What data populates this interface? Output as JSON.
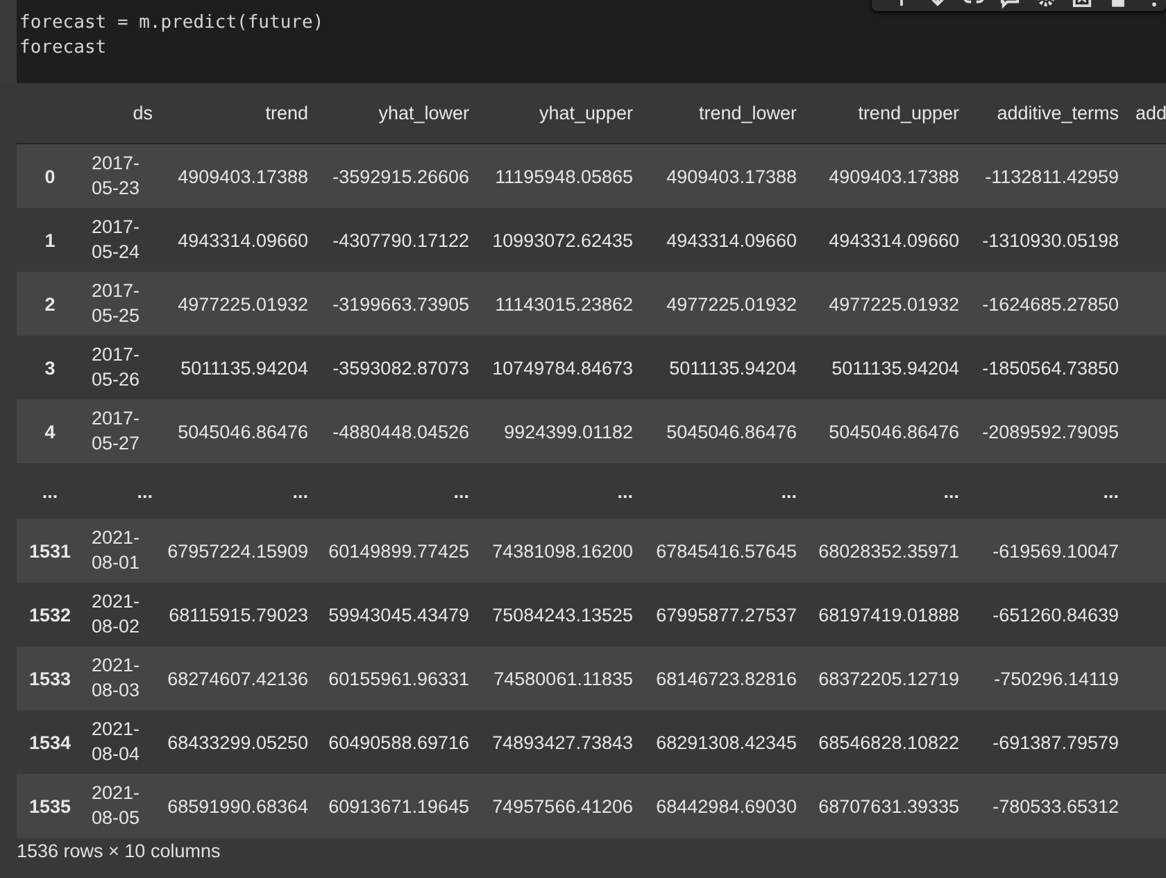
{
  "code_cell": {
    "lines": [
      "forecast = m.predict(future)",
      "forecast"
    ]
  },
  "table": {
    "columns": [
      "ds",
      "trend",
      "yhat_lower",
      "yhat_upper",
      "trend_lower",
      "trend_upper",
      "additive_terms",
      "add"
    ],
    "rows": [
      {
        "kind": "data",
        "index": "0",
        "cells": [
          "2017-05-23",
          "4909403.17388",
          "-3592915.26606",
          "11195948.05865",
          "4909403.17388",
          "4909403.17388",
          "-1132811.42959"
        ]
      },
      {
        "kind": "data",
        "index": "1",
        "cells": [
          "2017-05-24",
          "4943314.09660",
          "-4307790.17122",
          "10993072.62435",
          "4943314.09660",
          "4943314.09660",
          "-1310930.05198"
        ]
      },
      {
        "kind": "data",
        "index": "2",
        "cells": [
          "2017-05-25",
          "4977225.01932",
          "-3199663.73905",
          "11143015.23862",
          "4977225.01932",
          "4977225.01932",
          "-1624685.27850"
        ]
      },
      {
        "kind": "data",
        "index": "3",
        "cells": [
          "2017-05-26",
          "5011135.94204",
          "-3593082.87073",
          "10749784.84673",
          "5011135.94204",
          "5011135.94204",
          "-1850564.73850"
        ]
      },
      {
        "kind": "data",
        "index": "4",
        "cells": [
          "2017-05-27",
          "5045046.86476",
          "-4880448.04526",
          "9924399.01182",
          "5045046.86476",
          "5045046.86476",
          "-2089592.79095"
        ]
      },
      {
        "kind": "ellipsis",
        "index": "...",
        "cells": [
          "...",
          "...",
          "...",
          "...",
          "...",
          "...",
          "..."
        ]
      },
      {
        "kind": "data",
        "index": "1531",
        "cells": [
          "2021-08-01",
          "67957224.15909",
          "60149899.77425",
          "74381098.16200",
          "67845416.57645",
          "68028352.35971",
          "-619569.10047"
        ]
      },
      {
        "kind": "data",
        "index": "1532",
        "cells": [
          "2021-08-02",
          "68115915.79023",
          "59943045.43479",
          "75084243.13525",
          "67995877.27537",
          "68197419.01888",
          "-651260.84639"
        ]
      },
      {
        "kind": "data",
        "index": "1533",
        "cells": [
          "2021-08-03",
          "68274607.42136",
          "60155961.96331",
          "74580061.11835",
          "68146723.82816",
          "68372205.12719",
          "-750296.14119"
        ]
      },
      {
        "kind": "data",
        "index": "1534",
        "cells": [
          "2021-08-04",
          "68433299.05250",
          "60490588.69716",
          "74893427.73843",
          "68291308.42345",
          "68546828.10822",
          "-691387.79579"
        ]
      },
      {
        "kind": "data",
        "index": "1535",
        "cells": [
          "2021-08-05",
          "68591990.68364",
          "60913671.19645",
          "74957566.41206",
          "68442984.69030",
          "68707631.39335",
          "-780533.65312"
        ]
      }
    ]
  },
  "footer": "1536 rows × 10 columns"
}
